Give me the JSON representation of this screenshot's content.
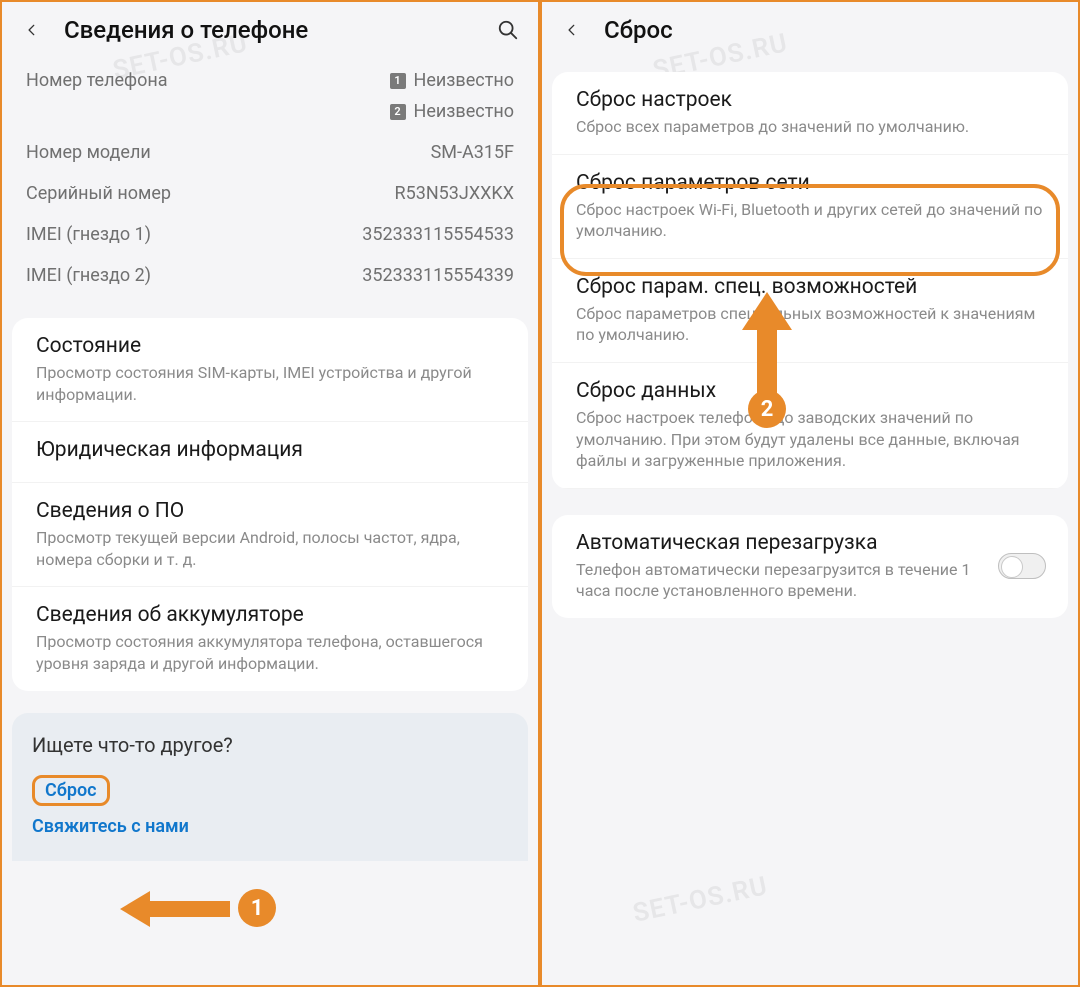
{
  "left": {
    "header_title": "Сведения о телефоне",
    "info": {
      "phone_label": "Номер телефона",
      "phone_sim1": "Неизвестно",
      "phone_sim2": "Неизвестно",
      "sim_badge_1": "1",
      "sim_badge_2": "2",
      "model_label": "Номер модели",
      "model_value": "SM-A315F",
      "serial_label": "Серийный номер",
      "serial_value": "R53N53JXXKX",
      "imei1_label": "IMEI (гнездо 1)",
      "imei1_value": "352333115554533",
      "imei2_label": "IMEI (гнездо 2)",
      "imei2_value": "352333115554339"
    },
    "items": [
      {
        "title": "Состояние",
        "desc": "Просмотр состояния SIM-карты, IMEI устройства и другой информации."
      },
      {
        "title": "Юридическая информация",
        "desc": ""
      },
      {
        "title": "Сведения о ПО",
        "desc": "Просмотр текущей версии Android, полосы частот, ядра, номера сборки и т. д."
      },
      {
        "title": "Сведения об аккумуляторе",
        "desc": "Просмотр состояния аккумулятора телефона, оставшегося уровня заряда и другой информации."
      }
    ],
    "other": {
      "question": "Ищете что-то другое?",
      "reset_link": "Сброс",
      "contact_link": "Свяжитесь с нами"
    },
    "badge1": "1"
  },
  "right": {
    "header_title": "Сброс",
    "items": [
      {
        "title": "Сброс настроек",
        "desc": "Сброс всех параметров до значений по умолчанию."
      },
      {
        "title": "Сброс параметров сети",
        "desc": "Сброс настроек Wi-Fi, Bluetooth и других сетей до значений по умолчанию."
      },
      {
        "title": "Сброс парам. спец. возможностей",
        "desc": "Сброс параметров специальных возможностей к значениям по умолчанию."
      },
      {
        "title": "Сброс данных",
        "desc": "Сброс настроек телефона до заводских значений по умолчанию. При этом будут удалены все данные, включая файлы и загруженные приложения."
      }
    ],
    "auto_reboot": {
      "title": "Автоматическая перезагрузка",
      "desc": "Телефон автоматически перезагрузится в течение 1 часа после установленного времени."
    },
    "badge2": "2"
  },
  "watermark": "SET-OS.RU"
}
